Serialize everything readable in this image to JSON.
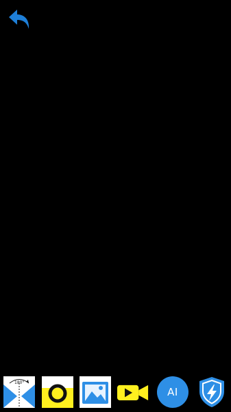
{
  "screen": {
    "background": "#000000"
  },
  "header": {
    "back_icon": "undo-arrow-icon",
    "back_color": "#1E7FD8"
  },
  "toolbar": {
    "items": [
      {
        "icon": "rotate-180-icon",
        "badge": "180°"
      },
      {
        "icon": "shutter-ring-icon"
      },
      {
        "icon": "gallery-image-icon"
      },
      {
        "icon": "video-camera-icon"
      },
      {
        "icon": "ai-badge-icon",
        "label": "AI"
      },
      {
        "icon": "shield-bolt-icon"
      }
    ],
    "colors": {
      "blue": "#2E8FE6",
      "yellow": "#FFF01F"
    }
  }
}
